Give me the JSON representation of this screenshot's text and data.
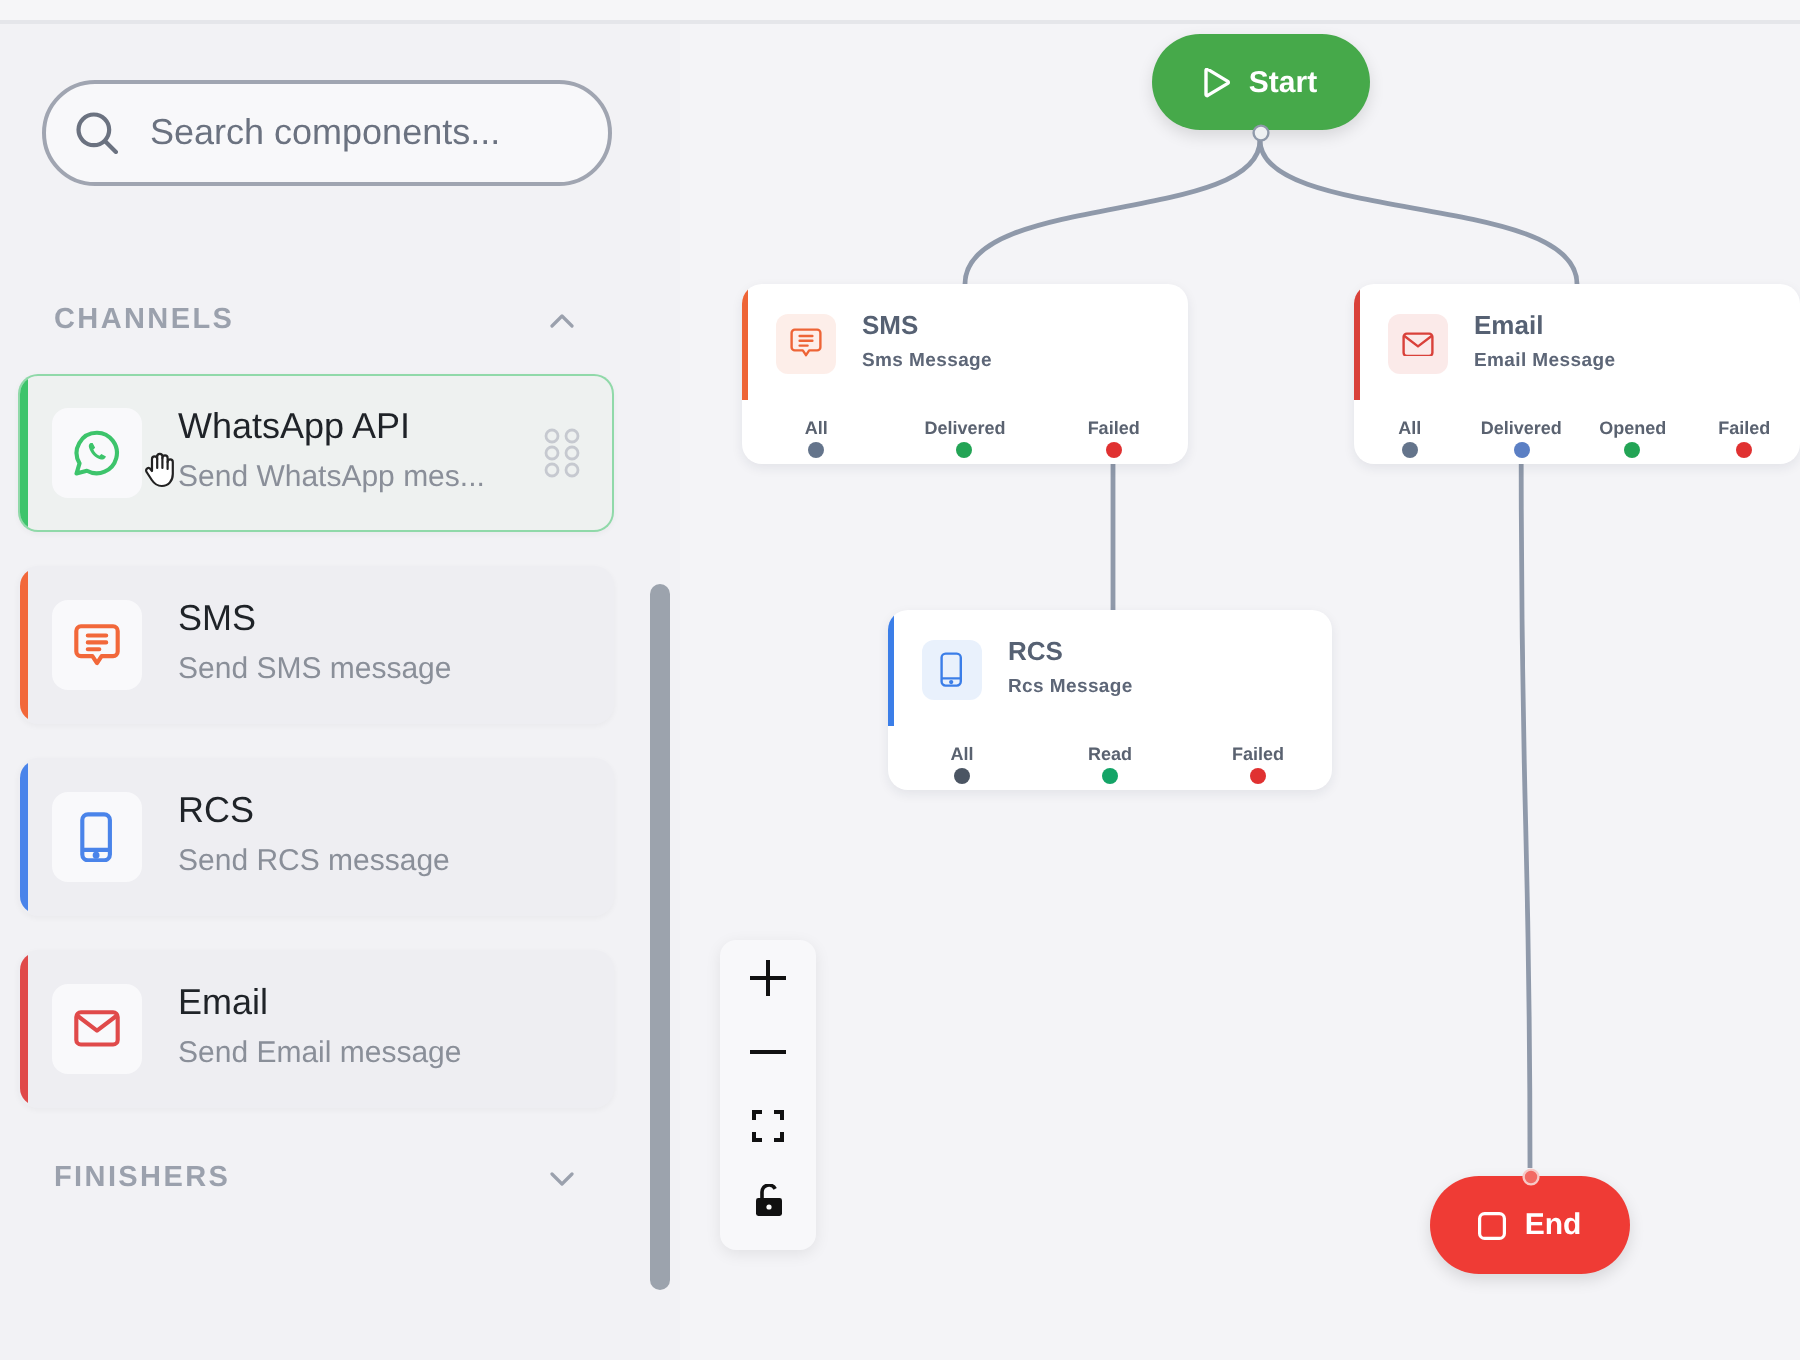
{
  "search": {
    "placeholder": "Search components..."
  },
  "sidebar": {
    "sections": [
      {
        "title": "CHANNELS",
        "expanded": true,
        "items": [
          {
            "kind": "whatsapp",
            "title": "WhatsApp API",
            "subtitle": "Send WhatsApp mes...",
            "color": "#3dc46b",
            "hovered": true
          },
          {
            "kind": "sms",
            "title": "SMS",
            "subtitle": "Send SMS message",
            "color": "#f2683a",
            "hovered": false
          },
          {
            "kind": "rcs",
            "title": "RCS",
            "subtitle": "Send RCS message",
            "color": "#4a84ea",
            "hovered": false
          },
          {
            "kind": "email",
            "title": "Email",
            "subtitle": "Send Email message",
            "color": "#e04a4a",
            "hovered": false
          }
        ]
      },
      {
        "title": "FINISHERS",
        "expanded": false
      }
    ]
  },
  "canvas": {
    "nodes": [
      {
        "kind": "start",
        "label": "Start"
      },
      {
        "kind": "sms",
        "title": "SMS",
        "subtitle": "Sms Message",
        "color": "#ee6436",
        "outputs": [
          {
            "label": "All",
            "color": "#64748b"
          },
          {
            "label": "Delivered",
            "color": "#23a455"
          },
          {
            "label": "Failed",
            "color": "#e03131"
          }
        ]
      },
      {
        "kind": "email",
        "title": "Email",
        "subtitle": "Email Message",
        "color": "#d9413a",
        "outputs": [
          {
            "label": "All",
            "color": "#64748b"
          },
          {
            "label": "Delivered",
            "color": "#5b7fc4"
          },
          {
            "label": "Opened",
            "color": "#23a455"
          },
          {
            "label": "Failed",
            "color": "#e03131"
          }
        ]
      },
      {
        "kind": "rcs",
        "title": "RCS",
        "subtitle": "Rcs Message",
        "color": "#3b7ee8",
        "outputs": [
          {
            "label": "All",
            "color": "#4b5563"
          },
          {
            "label": "Read",
            "color": "#14a467"
          },
          {
            "label": "Failed",
            "color": "#e03131"
          }
        ]
      },
      {
        "kind": "end",
        "label": "End"
      }
    ],
    "controls": {
      "locked": false
    }
  }
}
